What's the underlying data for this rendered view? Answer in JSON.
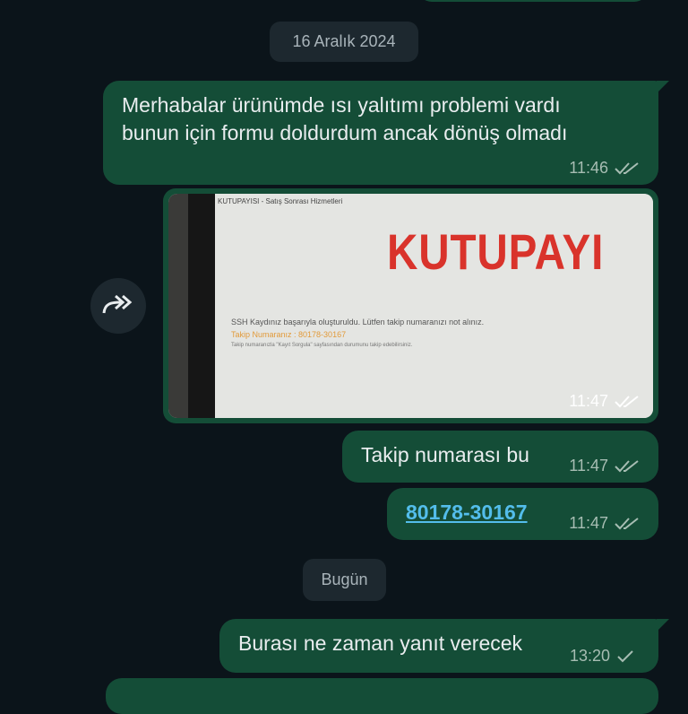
{
  "chat": {
    "date_chips": [
      "16 Aralık 2024",
      "Bugün"
    ],
    "messages": [
      {
        "lines": [
          "Merhabalar ürünümde ısı yalıtımı problemi vardı",
          "bunun için formu doldurdum ancak dönüş olmadı"
        ],
        "time": "11:46",
        "status": "read"
      },
      {
        "type": "image",
        "time": "11:47",
        "status": "read",
        "image": {
          "header": "KUTUPAYISI - Satış Sonrası Hizmetleri",
          "logo": "KUTUPAYI",
          "line1": "SSH Kaydınız başarıyla oluşturuldu. Lütfen takip numaranızı not alınız.",
          "line2": "Takip Numaranız : 80178-30167",
          "line3": "Takip numaranızla \"Kayıt Sorgula\" sayfasından durumunu takip edebilirsiniz."
        }
      },
      {
        "text": "Takip numarası bu",
        "time": "11:47",
        "status": "read"
      },
      {
        "text": "80178-30167",
        "time": "11:47",
        "status": "read",
        "is_link": true
      },
      {
        "text": "Burası ne zaman yanıt verecek",
        "time": "13:20",
        "status": "sent"
      }
    ]
  },
  "icons": {
    "forward": "forward-icon",
    "read": "double-check-icon",
    "sent": "single-check-icon"
  },
  "colors": {
    "background": "#0b141a",
    "outgoing_bubble": "#144d37",
    "link": "#53bdeb",
    "logo_red": "#d9332b"
  }
}
